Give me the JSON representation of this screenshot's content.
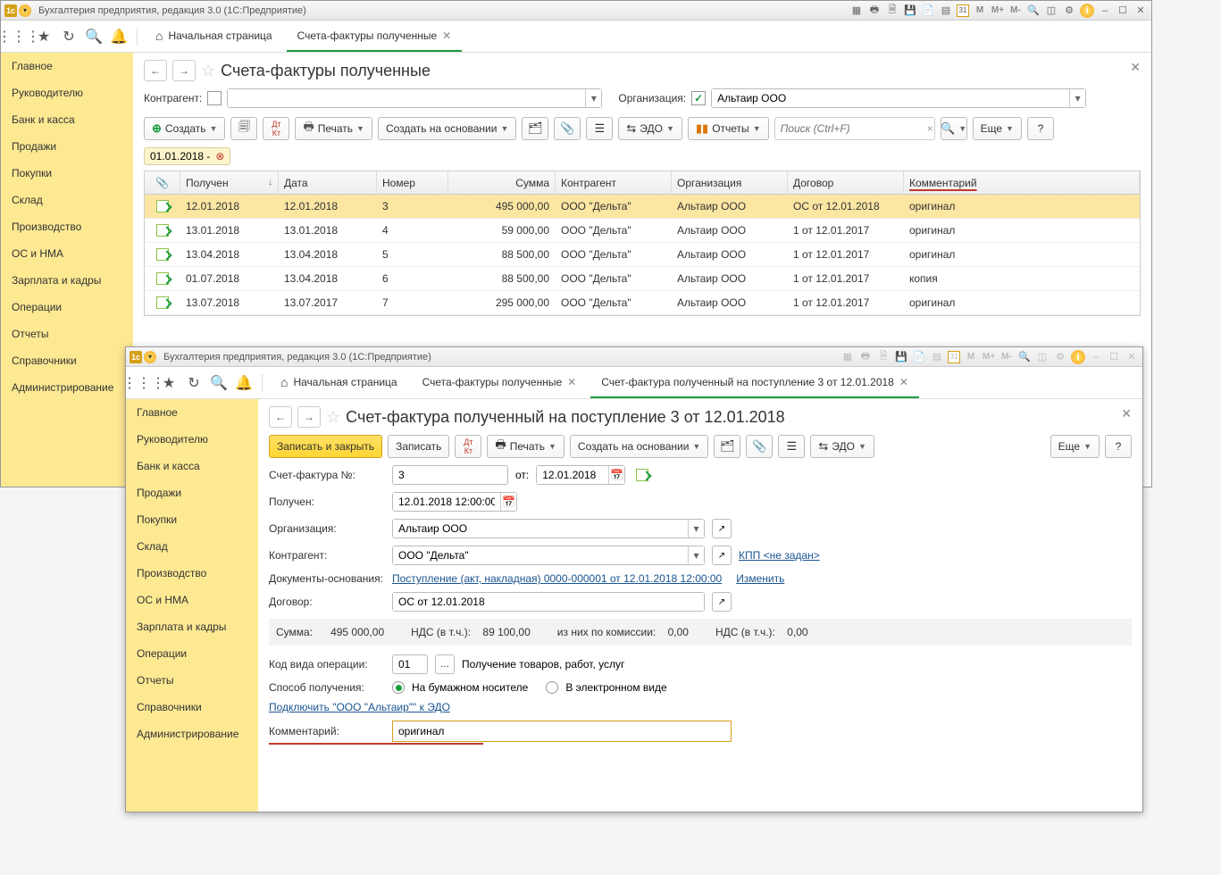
{
  "app_title": "Бухгалтерия предприятия, редакция 3.0  (1С:Предприятие)",
  "toolbar": {
    "home": "Начальная страница",
    "tab_active": "Счета-фактуры полученные"
  },
  "sidebar": [
    "Главное",
    "Руководителю",
    "Банк и касса",
    "Продажи",
    "Покупки",
    "Склад",
    "Производство",
    "ОС и НМА",
    "Зарплата и кадры",
    "Операции",
    "Отчеты",
    "Справочники",
    "Администрирование"
  ],
  "page": {
    "title": "Счета-фактуры полученные",
    "kontragent_lbl": "Контрагент:",
    "org_lbl": "Организация:",
    "org_val": "Альтаир ООО"
  },
  "buttons": {
    "create": "Создать",
    "print": "Печать",
    "create_based": "Создать на основании",
    "edo": "ЭДО",
    "reports": "Отчеты",
    "more": "Еще",
    "help": "?",
    "search_ph": "Поиск (Ctrl+F)"
  },
  "date_filter": "01.01.2018 -",
  "cols": {
    "received": "Получен",
    "date": "Дата",
    "number": "Номер",
    "sum": "Сумма",
    "ka": "Контрагент",
    "org": "Организация",
    "dog": "Договор",
    "com": "Комментарий"
  },
  "rows": [
    {
      "rec": "12.01.2018",
      "date": "12.01.2018",
      "num": "3",
      "sum": "495 000,00",
      "ka": "ООО \"Дельта\"",
      "org": "Альтаир ООО",
      "dog": "ОС от 12.01.2018",
      "com": "оригинал"
    },
    {
      "rec": "13.01.2018",
      "date": "13.01.2018",
      "num": "4",
      "sum": "59 000,00",
      "ka": "ООО \"Дельта\"",
      "org": "Альтаир ООО",
      "dog": "1 от 12.01.2017",
      "com": "оригинал"
    },
    {
      "rec": "13.04.2018",
      "date": "13.04.2018",
      "num": "5",
      "sum": "88 500,00",
      "ka": "ООО \"Дельта\"",
      "org": "Альтаир ООО",
      "dog": "1 от 12.01.2017",
      "com": "оригинал"
    },
    {
      "rec": "01.07.2018",
      "date": "13.04.2018",
      "num": "6",
      "sum": "88 500,00",
      "ka": "ООО \"Дельта\"",
      "org": "Альтаир ООО",
      "dog": "1 от 12.01.2017",
      "com": "копия"
    },
    {
      "rec": "13.07.2018",
      "date": "13.07.2017",
      "num": "7",
      "sum": "295 000,00",
      "ka": "ООО \"Дельта\"",
      "org": "Альтаир ООО",
      "dog": "1 от 12.01.2017",
      "com": "оригинал"
    }
  ],
  "win2": {
    "toolbar": {
      "home": "Начальная страница",
      "tab1": "Счета-фактуры полученные",
      "tab2": "Счет-фактура полученный на поступление 3 от 12.01.2018"
    },
    "title": "Счет-фактура полученный на поступление 3 от 12.01.2018",
    "btn": {
      "save_close": "Записать и закрыть",
      "save": "Записать",
      "print": "Печать",
      "create_based": "Создать на основании",
      "edo": "ЭДО",
      "more": "Еще",
      "help": "?"
    },
    "f": {
      "num_lbl": "Счет-фактура №:",
      "num": "3",
      "ot": "от:",
      "ot_val": "12.01.2018",
      "rec_lbl": "Получен:",
      "rec_val": "12.01.2018 12:00:00",
      "org_lbl": "Организация:",
      "org_val": "Альтаир ООО",
      "ka_lbl": "Контрагент:",
      "ka_val": "ООО \"Дельта\"",
      "kpp": "КПП <не задан>",
      "basis_lbl": "Документы-основания:",
      "basis_link": "Поступление (акт, накладная) 0000-000001 от 12.01.2018 12:00:00",
      "change": "Изменить",
      "dog_lbl": "Договор:",
      "dog_val": "ОС от 12.01.2018",
      "summary": {
        "sum_lbl": "Сумма:",
        "sum": "495 000,00",
        "nds_lbl": "НДС (в т.ч.):",
        "nds": "89 100,00",
        "kom_lbl": "из них по комиссии:",
        "kom": "0,00",
        "nds2_lbl": "НДС (в т.ч.):",
        "nds2": "0,00"
      },
      "code_lbl": "Код вида операции:",
      "code": "01",
      "code_desc": "Получение товаров, работ, услуг",
      "method_lbl": "Способ получения:",
      "paper": "На бумажном носителе",
      "electronic": "В электронном виде",
      "connect": "Подключить \"ООО \"Альтаир\"\" к ЭДО",
      "com_lbl": "Комментарий:",
      "com_val": "оригинал"
    }
  },
  "tb_labels": {
    "m": "M",
    "mp": "M+",
    "mm": "M-",
    "cal": "31"
  }
}
